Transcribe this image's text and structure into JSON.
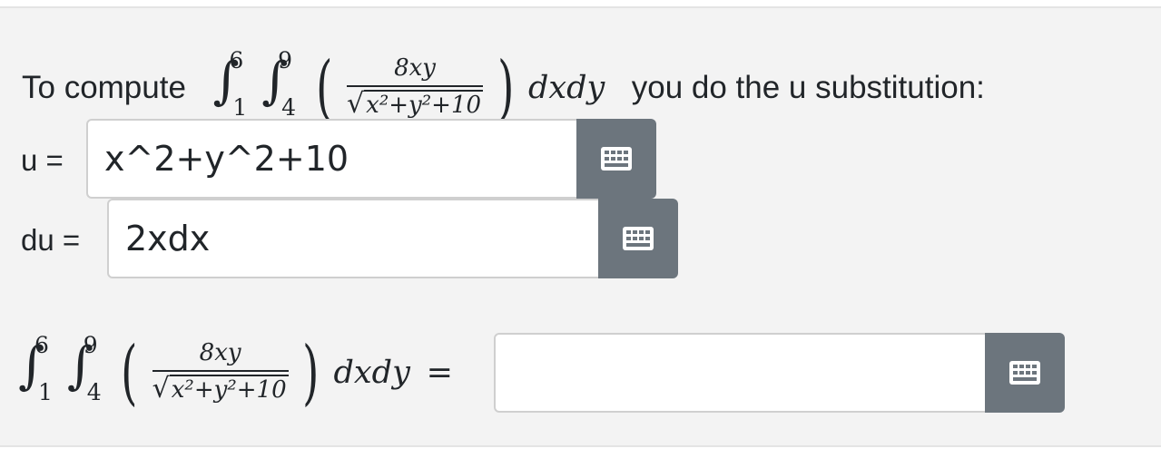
{
  "question": {
    "prefix": "To compute",
    "suffix": "you do the u substitution:",
    "integral_outer": {
      "upper": "6",
      "lower": "1"
    },
    "integral_inner": {
      "upper": "9",
      "lower": "4"
    },
    "numerator": "8xy",
    "radicand": "x²+y²+10",
    "differential": "dxdy"
  },
  "u_row": {
    "label": "u =",
    "value": "x^2+y^2+10"
  },
  "du_row": {
    "label": "du =",
    "value": "2xdx"
  },
  "answer_row": {
    "integral_outer": {
      "upper": "6",
      "lower": "1"
    },
    "integral_inner": {
      "upper": "9",
      "lower": "4"
    },
    "numerator": "8xy",
    "radicand": "x²+y²+10",
    "differential": "dxdy",
    "equals": "=",
    "value": ""
  },
  "keyboard_icon": "keyboard-icon",
  "colors": {
    "button": "#6c757d",
    "panel": "#f3f3f3",
    "border": "#cfcfcf"
  }
}
